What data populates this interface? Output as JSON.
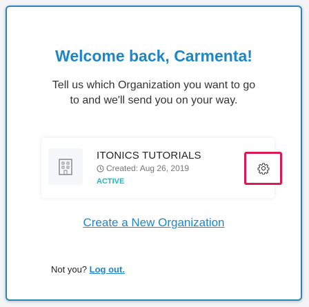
{
  "welcome": {
    "title": "Welcome back, Carmenta!",
    "subtitle_line1": "Tell us which Organization you want to go",
    "subtitle_line2": "to and we'll send you on your way."
  },
  "organization": {
    "name": "ITONICS TUTORIALS",
    "created": "Created: Aug 26, 2019",
    "status": "ACTIVE",
    "icon": "building-icon",
    "settings_icon": "gear-icon"
  },
  "actions": {
    "create_org": "Create a New Organization",
    "not_you": "Not you?",
    "logout": "Log out."
  },
  "colors": {
    "accent": "#1d86c6",
    "status": "#20b6c0",
    "highlight": "#d81b55"
  }
}
